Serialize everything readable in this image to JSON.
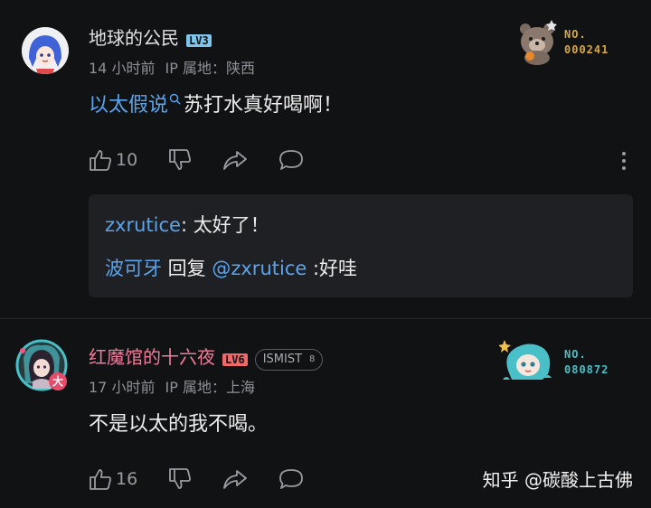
{
  "colors": {
    "background": "#111214",
    "link": "#5aa4ee",
    "pink_name": "#f07a9a",
    "lv3": "#7fc4ec",
    "lv6": "#ee6a6a",
    "gold": "#d9a940",
    "teal": "#49c0c8"
  },
  "comment1": {
    "username": "地球的公民",
    "level": "LV3",
    "time": "14 小时前",
    "ip": "IP 属地：陕西",
    "content_link": "以太假说",
    "content_text": "苏打水真好喝啊！",
    "likes": "10",
    "badge_title": "NO.",
    "badge_number": "000241",
    "replies": [
      {
        "user": "zxrutice",
        "sep": ":",
        "text": " 太好了！"
      },
      {
        "user": "波可牙",
        "mid": " 回复 ",
        "target": "@zxrutice",
        "text": " :好哇"
      }
    ]
  },
  "comment2": {
    "username": "红魔馆的十六夜",
    "level": "LV6",
    "tag": "ISMIST",
    "tag_count": "8",
    "time": "17 小时前",
    "ip": "IP 属地：上海",
    "content_text": "不是以太的我不喝。",
    "likes": "16",
    "badge_title": "NO.",
    "badge_number": "080872",
    "avatar_mark": "大"
  },
  "watermark": "知乎 @碳酸上古佛",
  "icons": [
    "like-icon",
    "dislike-icon",
    "share-icon",
    "comment-icon",
    "more-icon",
    "search-icon"
  ]
}
